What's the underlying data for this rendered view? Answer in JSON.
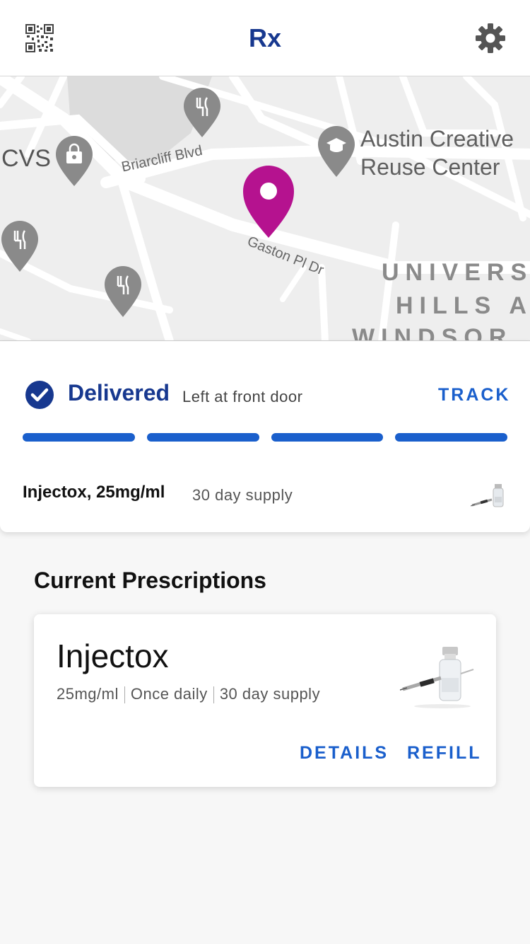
{
  "header": {
    "title": "Rx",
    "left_icon": "qr-code-icon",
    "right_icon": "gear-icon"
  },
  "map": {
    "labels": {
      "austin_line1": "Austin Creative",
      "austin_line2": "Reuse Center",
      "cvs": "CVS",
      "briarcliff": "Briarcliff Blvd",
      "gaston": "Gaston Pl Dr",
      "university": "UNIVERS",
      "hills": "HILLS A",
      "windsor": "WINDSOR"
    },
    "marker_color": "#b5128f",
    "poi_icons": [
      "restaurant-pin-icon",
      "shopping-pin-icon",
      "school-pin-icon"
    ]
  },
  "delivery": {
    "status": "Delivered",
    "status_note": "Left at front door",
    "track_label": "TRACK",
    "progress_steps_total": 4,
    "progress_steps_complete": 4,
    "medication": "Injectox, 25mg/ml",
    "supply": "30 day supply"
  },
  "prescriptions": {
    "section_title": "Current Prescriptions",
    "items": [
      {
        "name": "Injectox",
        "dosage": "25mg/ml",
        "frequency": "Once daily",
        "supply": "30 day supply",
        "details_label": "DETAILS",
        "refill_label": "REFILL"
      }
    ]
  },
  "colors": {
    "brand": "#17388f",
    "accent": "#1a5fcc",
    "marker": "#b5128f"
  }
}
